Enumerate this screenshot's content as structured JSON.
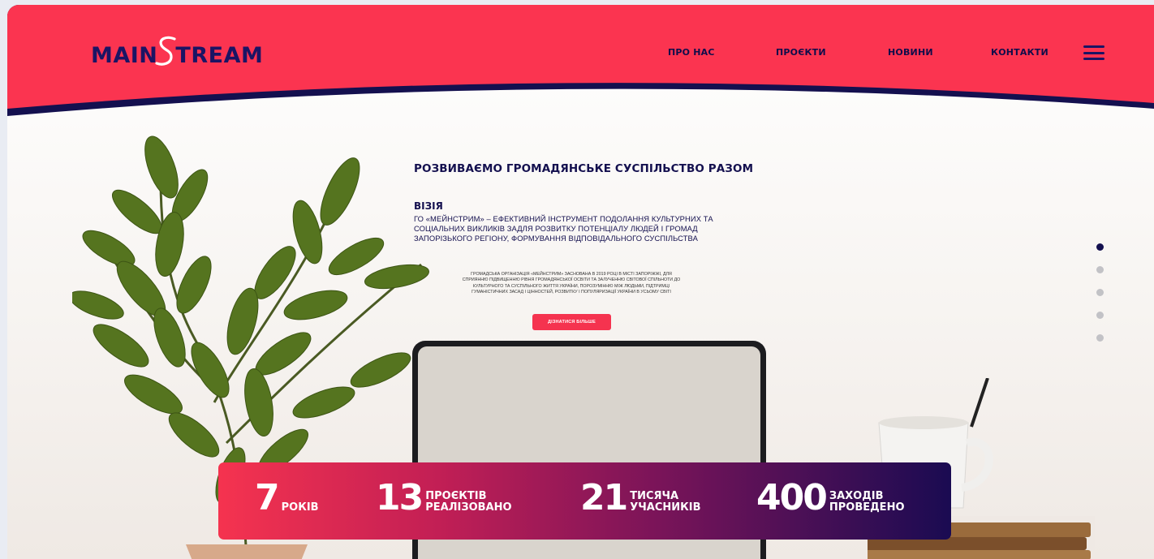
{
  "logo": {
    "before": "MAIN",
    "after": "TREAM"
  },
  "nav": {
    "items": [
      {
        "label": "ПРО НАС"
      },
      {
        "label": "ПРОЄКТИ"
      },
      {
        "label": "НОВИНИ"
      },
      {
        "label": "КОНТАКТИ"
      }
    ],
    "menu_icon": "hamburger-icon"
  },
  "hero": {
    "title": "РОЗВИВАЄМО ГРОМАДЯНСЬКЕ СУСПІЛЬСТВО РАЗОМ",
    "vision_title": "ВІЗІЯ",
    "vision_text": "ГО «МЕЙНСТРИМ» – ЕФЕКТИВНИЙ  ІНСТРУМЕНТ ПОДОЛАННЯ КУЛЬТУРНИХ ТА СОЦІАЛЬНИХ ВИКЛИКІВ ЗАДЛЯ РОЗВИТКУ ПОТЕНЦІАЛУ ЛЮДЕЙ І ГРОМАД ЗАПОРІЗЬКОГО РЕГІОНУ, ФОРМУВАННЯ ВІДПОВІДАЛЬНОГО СУСПІЛЬСТВА",
    "about_text": "ГРОМАДСЬКА ОРГАНІЗАЦІЯ «МЕЙНСТРИМ» ЗАСНОВАНА В 2019 РОЦІ В МІСТІ ЗАПОРІЖЖІ, ДЛЯ СПРИЯННЮ ПІДВИЩЕННЮ РІВНЯ ГРОМАДЯНСЬКОЇ ОСВІТИ ТА ЗАЛУЧЕННЮ СВІТОВОЇ СПІЛЬНОТИ ДО КУЛЬТУРНОГО ТА СУСПІЛЬНОГО ЖИТТЯ УКРАЇНИ, ПОРОЗУМІННЮ МІЖ ЛЮДЬМИ, ПІДТРИМЦІ ГУМАНІСТИЧНИХ ЗАСАД І ЦІННОСТЕЙ, РОЗВИТКУ І ПОПУЛЯРИЗАЦІЇ УКРАЇНИ В УСЬОМУ СВІТІ",
    "button_label": "ДІЗНАТИСЯ БІЛЬШЕ"
  },
  "stats": [
    {
      "number": "7",
      "label_line1": "",
      "label_line2": "РОКІВ"
    },
    {
      "number": "13",
      "label_line1": "ПРОЄКТІВ",
      "label_line2": "РЕАЛІЗОВАНО"
    },
    {
      "number": "21",
      "label_line1": "ТИСЯЧА",
      "label_line2": "УЧАСНИКІВ"
    },
    {
      "number": "400",
      "label_line1": "ЗАХОДІВ",
      "label_line2": "ПРОВЕДЕНО"
    }
  ],
  "slider": {
    "count": 5,
    "active_index": 0
  },
  "colors": {
    "brand_red": "#f5334f",
    "brand_navy": "#14104f",
    "stats_gradient_start": "#f5334f",
    "stats_gradient_end": "#1a0b52"
  }
}
